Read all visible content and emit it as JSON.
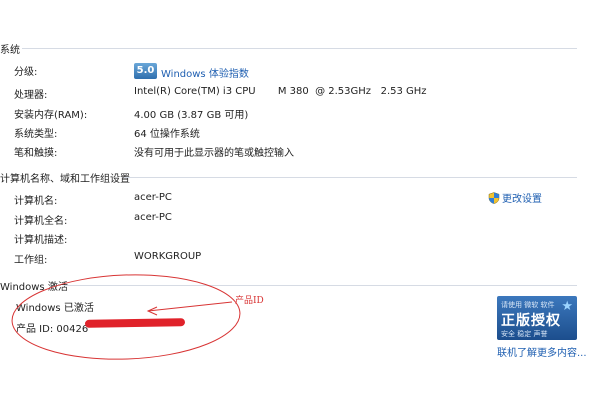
{
  "system": {
    "header": "系统",
    "rows": [
      {
        "label": "分级:",
        "wei_score": "5.0",
        "wei_link": "Windows 体验指数"
      },
      {
        "label": "处理器:",
        "value": "Intel(R) Core(TM) i3 CPU       M 380  @ 2.53GHz   2.53 GHz"
      },
      {
        "label": "安装内存(RAM):",
        "value": "4.00 GB (3.87 GB 可用)"
      },
      {
        "label": "系统类型:",
        "value": "64 位操作系统"
      },
      {
        "label": "笔和触摸:",
        "value": "没有可用于此显示器的笔或触控输入"
      }
    ]
  },
  "computer": {
    "header": "计算机名称、域和工作组设置",
    "change_settings": "更改设置",
    "rows": [
      {
        "label": "计算机名:",
        "value": "acer-PC"
      },
      {
        "label": "计算机全名:",
        "value": "acer-PC"
      },
      {
        "label": "计算机描述:",
        "value": ""
      },
      {
        "label": "工作组:",
        "value": "WORKGROUP"
      }
    ]
  },
  "activation": {
    "header": "Windows 激活",
    "status": "Windows 已激活",
    "product_id_label": "产品 ID: 00426",
    "annotation": "产品ID",
    "badge_top": "请使用 微软 软件",
    "badge_main": "正版授权",
    "badge_bottom": "安全 稳定 声誉",
    "more_link": "联机了解更多内容..."
  },
  "colors": {
    "link": "#1f5fb1",
    "annotation": "#d83434",
    "badge": "#2f6fae"
  },
  "icons": {
    "shield": "shield-icon",
    "star": "star-icon"
  }
}
